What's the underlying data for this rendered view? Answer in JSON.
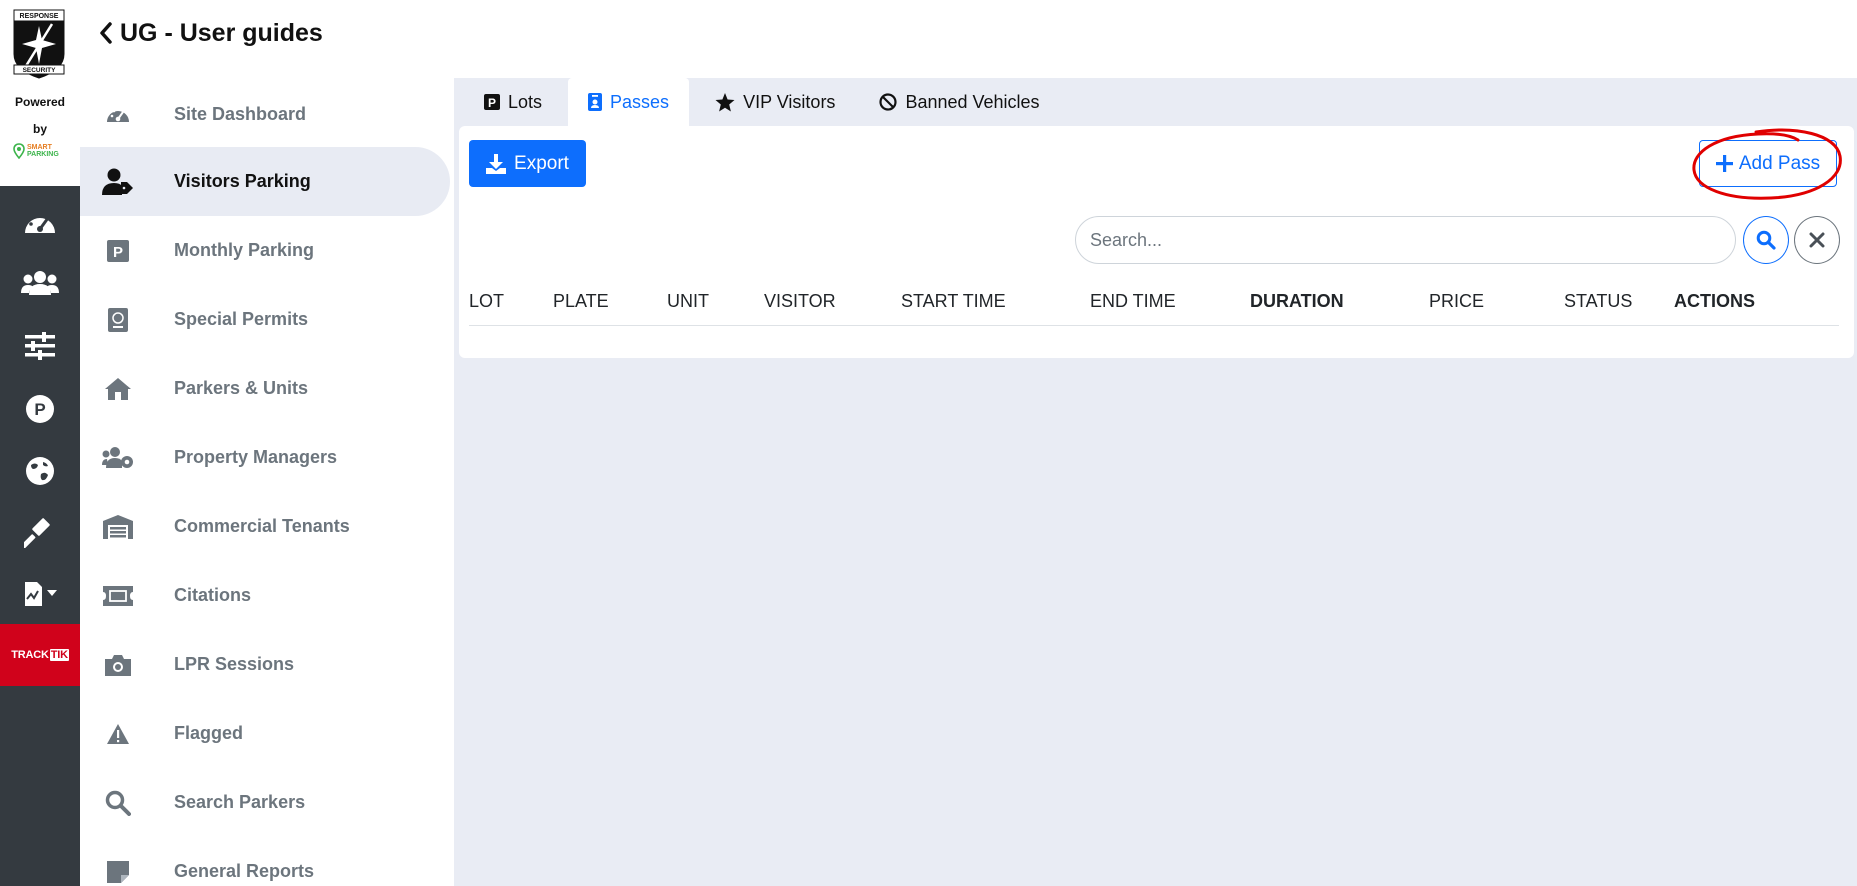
{
  "brand": {
    "shield_top_text": "RESPONSE",
    "shield_bottom_text": "SECURITY",
    "powered": "Powered",
    "by": "by",
    "smart_line1": "SMART",
    "smart_line2": "PARKING",
    "trackit_main": "TRACK",
    "trackit_badge": "TIK"
  },
  "rail": {
    "icons": [
      "dashboard-icon",
      "users-icon",
      "sliders-icon",
      "parking-icon",
      "globe-icon",
      "gavel-icon",
      "file-chart-icon"
    ]
  },
  "header": {
    "title": "UG - User guides"
  },
  "sidebar": {
    "items": [
      {
        "label": "Site Dashboard",
        "icon": "gauge-icon"
      },
      {
        "label": "Visitors Parking",
        "icon": "user-tag-icon"
      },
      {
        "label": "Monthly Parking",
        "icon": "parking-square-icon"
      },
      {
        "label": "Special Permits",
        "icon": "passport-icon"
      },
      {
        "label": "Parkers & Units",
        "icon": "home-icon"
      },
      {
        "label": "Property Managers",
        "icon": "users-cog-icon"
      },
      {
        "label": "Commercial Tenants",
        "icon": "warehouse-icon"
      },
      {
        "label": "Citations",
        "icon": "ticket-icon"
      },
      {
        "label": "LPR Sessions",
        "icon": "camera-icon"
      },
      {
        "label": "Flagged",
        "icon": "warning-icon"
      },
      {
        "label": "Search Parkers",
        "icon": "search-icon"
      },
      {
        "label": "General Reports",
        "icon": "note-icon"
      }
    ],
    "active_index": 1
  },
  "tabs": [
    {
      "label": "Lots",
      "icon": "parking-square-icon"
    },
    {
      "label": "Passes",
      "icon": "id-badge-icon"
    },
    {
      "label": "VIP Visitors",
      "icon": "star-icon"
    },
    {
      "label": "Banned Vehicles",
      "icon": "ban-icon"
    }
  ],
  "active_tab": "Passes",
  "toolbar": {
    "export_label": "Export",
    "add_label": "Add Pass"
  },
  "search": {
    "placeholder": "Search...",
    "value": ""
  },
  "table": {
    "columns": [
      "LOT",
      "PLATE",
      "UNIT",
      "VISITOR",
      "START TIME",
      "END TIME",
      "DURATION",
      "PRICE",
      "STATUS",
      "ACTIONS"
    ],
    "rows": []
  },
  "colors": {
    "primary": "#0d6efd",
    "rail_bg": "#343a40",
    "content_bg": "#e9ecf4",
    "active_nav_bg": "#e8ebf3",
    "trackit_red": "#d0021b",
    "annotation_red": "#e00000"
  }
}
